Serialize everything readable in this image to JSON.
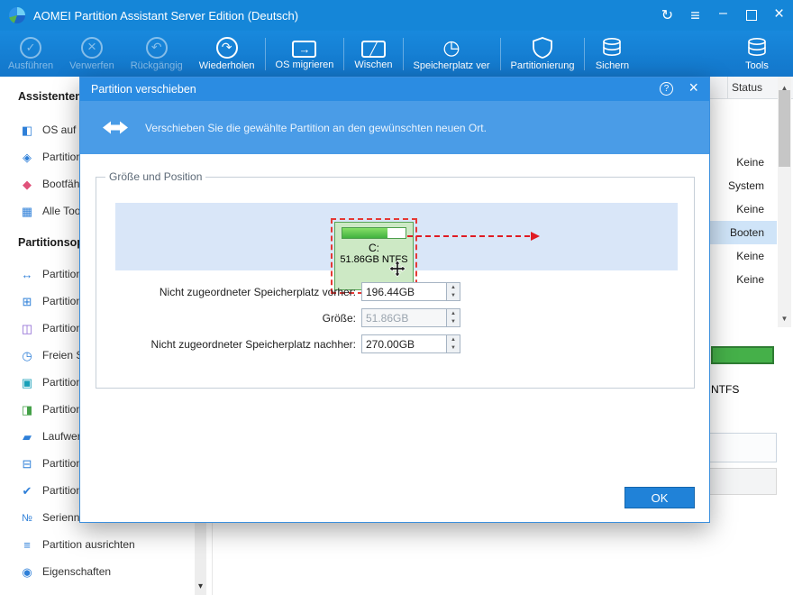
{
  "titlebar": {
    "title": "AOMEI Partition Assistant Server Edition (Deutsch)",
    "control_icons": [
      "refresh-icon",
      "menu-icon",
      "minimize-icon",
      "maximize-icon",
      "close-icon"
    ]
  },
  "colors": {
    "titlebar_blue": "#1586d8",
    "dialog_titlebar_blue": "#2b8ce2",
    "dialog_banner_blue": "#4a9ce7",
    "ok_button_blue": "#2082d8",
    "selection_dash_red": "#e53935",
    "partition_green": "#41b23f",
    "disk_strip_blue": "#d9e6f8",
    "status_selection_blue": "#cfe4f8"
  },
  "toolbar": {
    "buttons": [
      {
        "label": "Ausführen",
        "icon": "apply-check-icon",
        "disabled": true
      },
      {
        "label": "Verwerfen",
        "icon": "discard-icon",
        "disabled": true
      },
      {
        "label": "Rückgängig",
        "icon": "undo-icon",
        "disabled": true
      },
      {
        "label": "Wiederholen",
        "icon": "redo-icon",
        "disabled": false
      },
      {
        "label": "OS migrieren",
        "icon": "migrate-os-icon",
        "disabled": false
      },
      {
        "label": "Wischen",
        "icon": "wipe-disk-icon",
        "disabled": false
      },
      {
        "label": "Speicherplatz ver",
        "icon": "disk-analyze-icon",
        "disabled": false
      },
      {
        "label": "Partitionierung",
        "icon": "shield-icon",
        "disabled": false
      },
      {
        "label": "Sichern",
        "icon": "backup-disks-icon",
        "disabled": false
      },
      {
        "label": "Tools",
        "icon": "tools-disks-icon",
        "disabled": false
      }
    ]
  },
  "sidebar": {
    "rows": [
      {
        "type": "header",
        "label": "Assistenten"
      },
      {
        "type": "item",
        "label": "OS auf S",
        "icon": "monitor-icon"
      },
      {
        "type": "item",
        "label": "Partition",
        "icon": "partition-recover-icon"
      },
      {
        "type": "item",
        "label": "Bootfähi",
        "icon": "bootable-media-icon"
      },
      {
        "type": "item",
        "label": "Alle Tool",
        "icon": "all-tools-icon"
      },
      {
        "type": "header",
        "label": "Partitionsop"
      },
      {
        "type": "item",
        "label": "Partition",
        "icon": "resize-icon"
      },
      {
        "type": "item",
        "label": "Partition",
        "icon": "merge-icon"
      },
      {
        "type": "item",
        "label": "Partition",
        "icon": "split-icon"
      },
      {
        "type": "item",
        "label": "Freien Sp",
        "icon": "allocate-space-icon"
      },
      {
        "type": "item",
        "label": "Partition",
        "icon": "copy-icon"
      },
      {
        "type": "item",
        "label": "Partition",
        "icon": "format-icon"
      },
      {
        "type": "item",
        "label": "Laufwerk",
        "icon": "drive-letter-icon"
      },
      {
        "type": "item",
        "label": "Partition",
        "icon": "delete-icon"
      },
      {
        "type": "item",
        "label": "Partition",
        "icon": "check-icon"
      },
      {
        "type": "item",
        "label": "Seriennu",
        "icon": "serial-number-icon"
      },
      {
        "type": "item",
        "label": "Partition ausrichten",
        "icon": "align-icon"
      },
      {
        "type": "item",
        "label": "Eigenschaften",
        "icon": "properties-icon"
      }
    ]
  },
  "main": {
    "table": {
      "status_header": "Status",
      "status_values": [
        "Keine",
        "System",
        "Keine",
        "Booten",
        "Keine",
        "Keine"
      ],
      "selected_index": 3
    },
    "disk_fragment": {
      "filesystem_label": "NTFS"
    }
  },
  "dialog": {
    "title": "Partition verschieben",
    "description": "Verschieben Sie die gewählte Partition an den gewünschten neuen Ort.",
    "group_title": "Größe und Position",
    "partition": {
      "name": "C:",
      "detail": "51.86GB NTFS"
    },
    "fields": [
      {
        "label": "Nicht zugeordneter Speicherplatz vorher:",
        "value": "196.44GB",
        "disabled": false
      },
      {
        "label": "Größe:",
        "value": "51.86GB",
        "disabled": true
      },
      {
        "label": "Nicht zugeordneter Speicherplatz nachher:",
        "value": "270.00GB",
        "disabled": false
      }
    ],
    "ok_label": "OK"
  }
}
